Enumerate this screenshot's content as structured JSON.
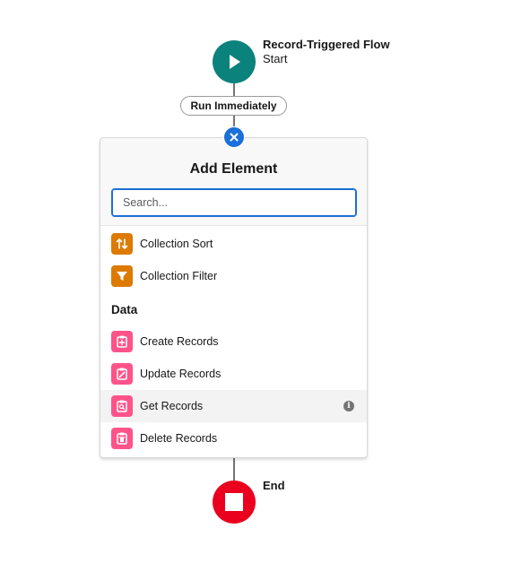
{
  "start": {
    "title": "Record-Triggered Flow",
    "subtitle": "Start",
    "icon": "play-icon",
    "color": "#0b827c"
  },
  "path": {
    "label": "Run Immediately"
  },
  "add_element": {
    "close_icon": "close-icon",
    "title": "Add Element",
    "search_placeholder": "Search...",
    "items_top": [
      {
        "label": "Collection Sort",
        "icon": "sort-icon",
        "color": "#dd7a01"
      },
      {
        "label": "Collection Filter",
        "icon": "filter-icon",
        "color": "#dd7a01"
      }
    ],
    "section_heading": "Data",
    "data_items": [
      {
        "label": "Create Records",
        "icon": "record-create-icon",
        "color": "#ff538a"
      },
      {
        "label": "Update Records",
        "icon": "record-update-icon",
        "color": "#ff538a"
      },
      {
        "label": "Get Records",
        "icon": "record-lookup-icon",
        "color": "#ff538a",
        "info_icon": "info-icon"
      },
      {
        "label": "Delete Records",
        "icon": "record-delete-icon",
        "color": "#ff538a"
      }
    ]
  },
  "end": {
    "label": "End",
    "icon": "stop-icon",
    "color": "#ea001e"
  }
}
